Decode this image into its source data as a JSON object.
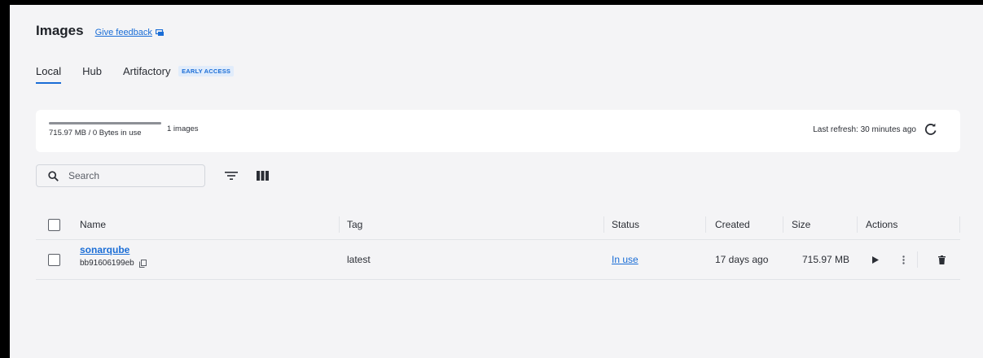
{
  "header": {
    "title": "Images",
    "feedback_label": "Give feedback"
  },
  "tabs": [
    {
      "label": "Local",
      "active": true
    },
    {
      "label": "Hub",
      "active": false
    },
    {
      "label": "Artifactory",
      "active": false,
      "badge": "EARLY ACCESS"
    }
  ],
  "usage": {
    "used_text": "715.97 MB / 0 Bytes in use",
    "count_text": "1 images",
    "fill_fraction": 1.0,
    "last_refresh": "Last refresh: 30 minutes ago",
    "refresh_icon": "refresh-icon"
  },
  "toolbar": {
    "search_placeholder": "Search",
    "filter_icon": "filter-icon",
    "columns_icon": "columns-icon"
  },
  "table": {
    "columns": [
      "Name",
      "Tag",
      "Status",
      "Created",
      "Size",
      "Actions"
    ],
    "rows": [
      {
        "name": "sonarqube",
        "id": "bb91606199eb",
        "tag": "latest",
        "status": "In use",
        "created": "17 days ago",
        "size": "715.97 MB"
      }
    ]
  },
  "colors": {
    "accent": "#1a6dd6",
    "background": "#f4f4f6",
    "card": "#ffffff"
  }
}
